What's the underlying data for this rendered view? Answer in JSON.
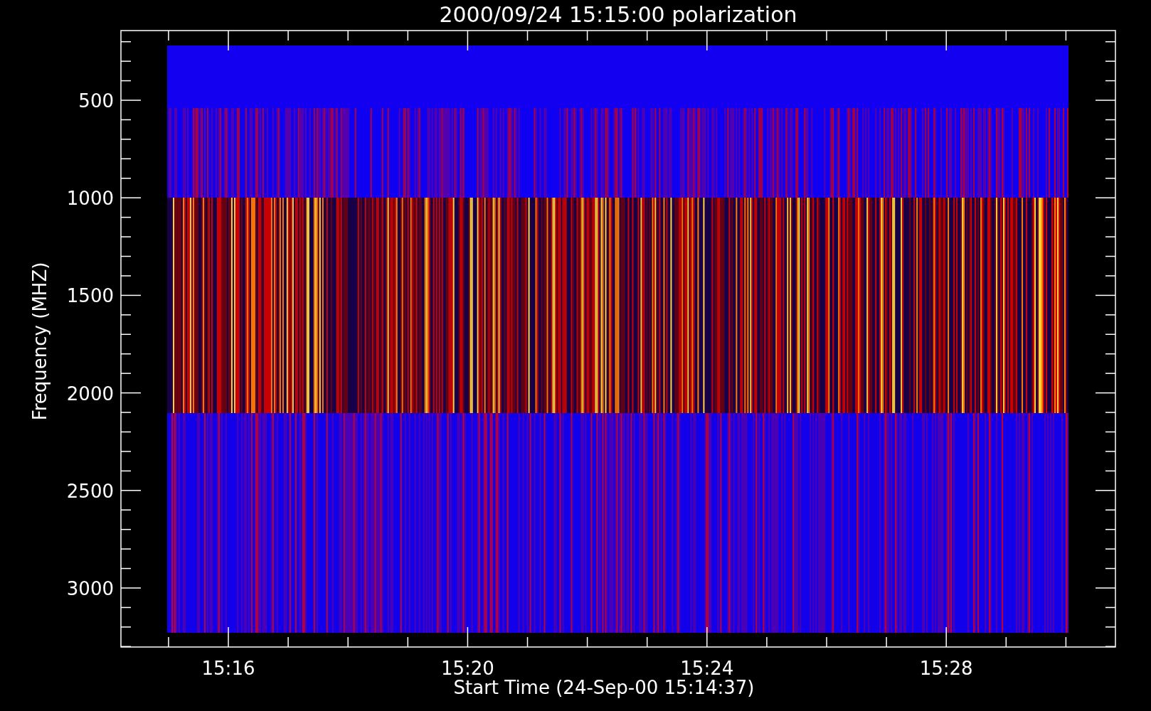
{
  "plot": {
    "title": "2000/09/24 15:15:00 polarization",
    "y_axis": {
      "label": "Frequency (MHZ)",
      "ticks": [
        "500",
        "1000",
        "1500",
        "2000",
        "2500",
        "3000"
      ]
    },
    "x_axis": {
      "label": "Start Time (24-Sep-00 15:14:37)",
      "ticks": [
        "15:16",
        "15:20",
        "15:24",
        "15:28"
      ]
    }
  }
}
